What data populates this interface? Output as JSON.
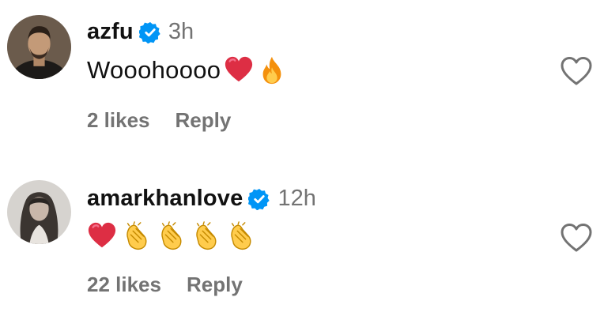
{
  "comments": [
    {
      "username": "azfu",
      "verified": true,
      "time": "3h",
      "text": "Wooohoooo",
      "emojis": [
        "red-heart",
        "fire"
      ],
      "likes": "2 likes",
      "reply_label": "Reply"
    },
    {
      "username": "amarkhanlove",
      "verified": true,
      "time": "12h",
      "text": "",
      "emojis": [
        "red-heart",
        "clapping-hands",
        "clapping-hands",
        "clapping-hands",
        "clapping-hands"
      ],
      "likes": "22 likes",
      "reply_label": "Reply"
    }
  ],
  "colors": {
    "verified_blue": "#0095f6",
    "secondary_text": "#737373",
    "primary_text": "#111111",
    "heart_red": "#e0245e",
    "heart_outline": "#737373"
  }
}
